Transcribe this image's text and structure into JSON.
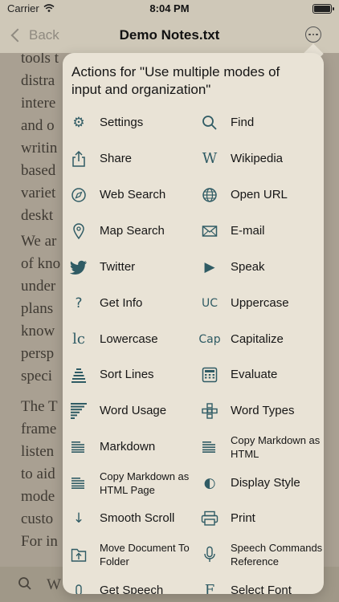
{
  "status_bar": {
    "carrier": "Carrier",
    "time": "8:04 PM"
  },
  "nav": {
    "back_label": "Back",
    "title": "Demo Notes.txt"
  },
  "document": {
    "lines": [
      "tools t",
      "distra",
      "intere",
      "and o",
      "writin",
      "based",
      "variet",
      "deskt",
      "We ar",
      "of kno",
      "under",
      "plans",
      "know",
      "persp",
      "speci",
      "The T",
      "frame",
      "listen",
      "to aid",
      "mode",
      "custo",
      "For in"
    ]
  },
  "bottom_bar": {
    "w_glyph": "W"
  },
  "popover": {
    "title": "Actions for \"Use multiple modes of input and organization\"",
    "actions": [
      {
        "label": "Settings",
        "icon": "gear-icon",
        "glyph": "⚙"
      },
      {
        "label": "Find",
        "icon": "magnifier-icon",
        "glyph": ""
      },
      {
        "label": "Share",
        "icon": "share-icon",
        "glyph": ""
      },
      {
        "label": "Wikipedia",
        "icon": "wikipedia-icon",
        "glyph": "W"
      },
      {
        "label": "Web Search",
        "icon": "compass-icon",
        "glyph": ""
      },
      {
        "label": "Open URL",
        "icon": "globe-icon",
        "glyph": ""
      },
      {
        "label": "Map Search",
        "icon": "map-pin-icon",
        "glyph": ""
      },
      {
        "label": "E-mail",
        "icon": "envelope-icon",
        "glyph": ""
      },
      {
        "label": "Twitter",
        "icon": "twitter-bird-icon",
        "glyph": ""
      },
      {
        "label": "Speak",
        "icon": "play-icon",
        "glyph": "▶"
      },
      {
        "label": "Get Info",
        "icon": "question-mark-icon",
        "glyph": "?"
      },
      {
        "label": "Uppercase",
        "icon": "uppercase-icon",
        "glyph": "UC"
      },
      {
        "label": "Lowercase",
        "icon": "lowercase-icon",
        "glyph": "lc"
      },
      {
        "label": "Capitalize",
        "icon": "capitalize-icon",
        "glyph": "Cap"
      },
      {
        "label": "Sort Lines",
        "icon": "sort-lines-icon",
        "glyph": ""
      },
      {
        "label": "Evaluate",
        "icon": "calculator-icon",
        "glyph": ""
      },
      {
        "label": "Word Usage",
        "icon": "word-usage-icon",
        "glyph": ""
      },
      {
        "label": "Word Types",
        "icon": "word-types-icon",
        "glyph": ""
      },
      {
        "label": "Markdown",
        "icon": "markdown-icon",
        "glyph": ""
      },
      {
        "label": "Copy Markdown as HTML",
        "icon": "copy-markdown-html-icon",
        "glyph": ""
      },
      {
        "label": "Copy Markdown as HTML Page",
        "icon": "copy-markdown-page-icon",
        "glyph": ""
      },
      {
        "label": "Display Style",
        "icon": "display-style-icon",
        "glyph": "◐"
      },
      {
        "label": "Smooth Scroll",
        "icon": "arrow-down-icon",
        "glyph": "↓"
      },
      {
        "label": "Print",
        "icon": "printer-icon",
        "glyph": ""
      },
      {
        "label": "Move Document To Folder",
        "icon": "move-to-folder-icon",
        "glyph": ""
      },
      {
        "label": "Speech Commands Reference",
        "icon": "microphone-icon",
        "glyph": ""
      },
      {
        "label": "Get Speech",
        "icon": "speech-icon",
        "glyph": ""
      },
      {
        "label": "Select Font",
        "icon": "font-icon",
        "glyph": "F"
      }
    ]
  }
}
